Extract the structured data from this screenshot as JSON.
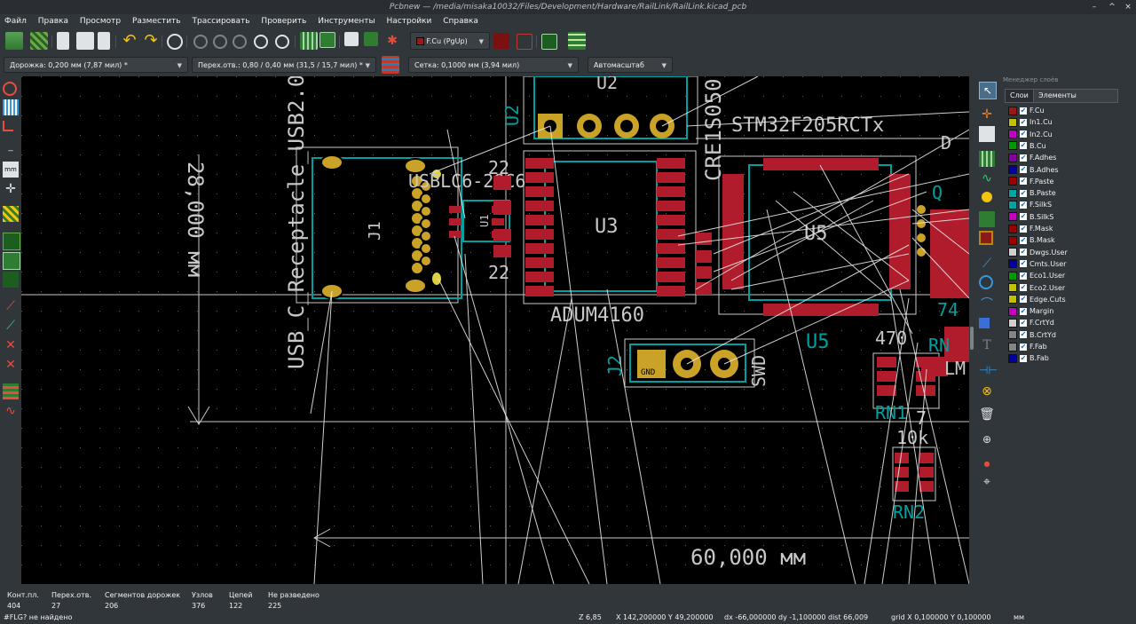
{
  "window": {
    "title": "Pcbnew — /media/misaka10032/Files/Development/Hardware/RailLink/RailLink.kicad_pcb"
  },
  "menu": [
    "Файл",
    "Правка",
    "Просмотр",
    "Разместить",
    "Трассировать",
    "Проверить",
    "Инструменты",
    "Настройки",
    "Справка"
  ],
  "toolbar": {
    "active_layer": "F.Cu (PgUp)",
    "track_width": "Дорожка: 0,200 мм (7,87 мил) *",
    "via_size": "Перех.отв.: 0,80 / 0,40 мм (31,5 / 15,7 мил) *",
    "grid": "Сетка: 0,1000 мм (3,94 мил)",
    "zoom": "Автомасштаб"
  },
  "layers_panel": {
    "title": "Менеджер слоёв",
    "tabs": [
      "Слои",
      "Элементы"
    ],
    "layers": [
      {
        "name": "F.Cu",
        "color": "#9a1818"
      },
      {
        "name": "In1.Cu",
        "color": "#c2c200"
      },
      {
        "name": "In2.Cu",
        "color": "#c200c2"
      },
      {
        "name": "B.Cu",
        "color": "#009a00"
      },
      {
        "name": "F.Adhes",
        "color": "#8400a0"
      },
      {
        "name": "B.Adhes",
        "color": "#00009a"
      },
      {
        "name": "F.Paste",
        "color": "#9a0000"
      },
      {
        "name": "B.Paste",
        "color": "#00a4a4"
      },
      {
        "name": "F.SilkS",
        "color": "#00a4a4"
      },
      {
        "name": "B.SilkS",
        "color": "#c200c2"
      },
      {
        "name": "F.Mask",
        "color": "#9a0000"
      },
      {
        "name": "B.Mask",
        "color": "#9a0000"
      },
      {
        "name": "Dwgs.User",
        "color": "#d0d0d0"
      },
      {
        "name": "Cmts.User",
        "color": "#00009a"
      },
      {
        "name": "Eco1.User",
        "color": "#009a00"
      },
      {
        "name": "Eco2.User",
        "color": "#c2c200"
      },
      {
        "name": "Edge.Cuts",
        "color": "#c2c200"
      },
      {
        "name": "Margin",
        "color": "#c200c2"
      },
      {
        "name": "F.CrtYd",
        "color": "#d0d0d0"
      },
      {
        "name": "B.CrtYd",
        "color": "#848484"
      },
      {
        "name": "F.Fab",
        "color": "#848484"
      },
      {
        "name": "B.Fab",
        "color": "#00009a"
      }
    ]
  },
  "board": {
    "refs": [
      "U2",
      "CRE1S050",
      "STM32F205RCTx",
      "U3",
      "U5",
      "U5",
      "J1",
      "USB_C_Receptacle_USB2.0",
      "USBLC6-2SC6",
      "U1",
      "22",
      "22",
      "ADUM4160",
      "J2",
      "SWD",
      "GND",
      "470",
      "RN1",
      "10k",
      "RN2",
      "LM",
      "7",
      "RN",
      "74",
      "Q",
      "D",
      "28,000 мм",
      "60,000 мм"
    ]
  },
  "status": {
    "pads_label": "Конт.пл.",
    "pads": "404",
    "vias_label": "Перех.отв.",
    "vias": "27",
    "segments_label": "Сегментов дорожек",
    "segments": "206",
    "nodes_label": "Узлов",
    "nodes": "376",
    "nets_label": "Цепей",
    "nets": "122",
    "unrouted_label": "Не разведено",
    "unrouted": "225",
    "message": "#FLG? не найдено",
    "zoom": "Z 6,85",
    "cursor": "X 142,200000  Y 49,200000",
    "delta": "dx -66,000000  dy -1,100000  dist 66,009",
    "gridinfo": "grid X 0,100000  Y 0,100000",
    "units": "мм"
  }
}
